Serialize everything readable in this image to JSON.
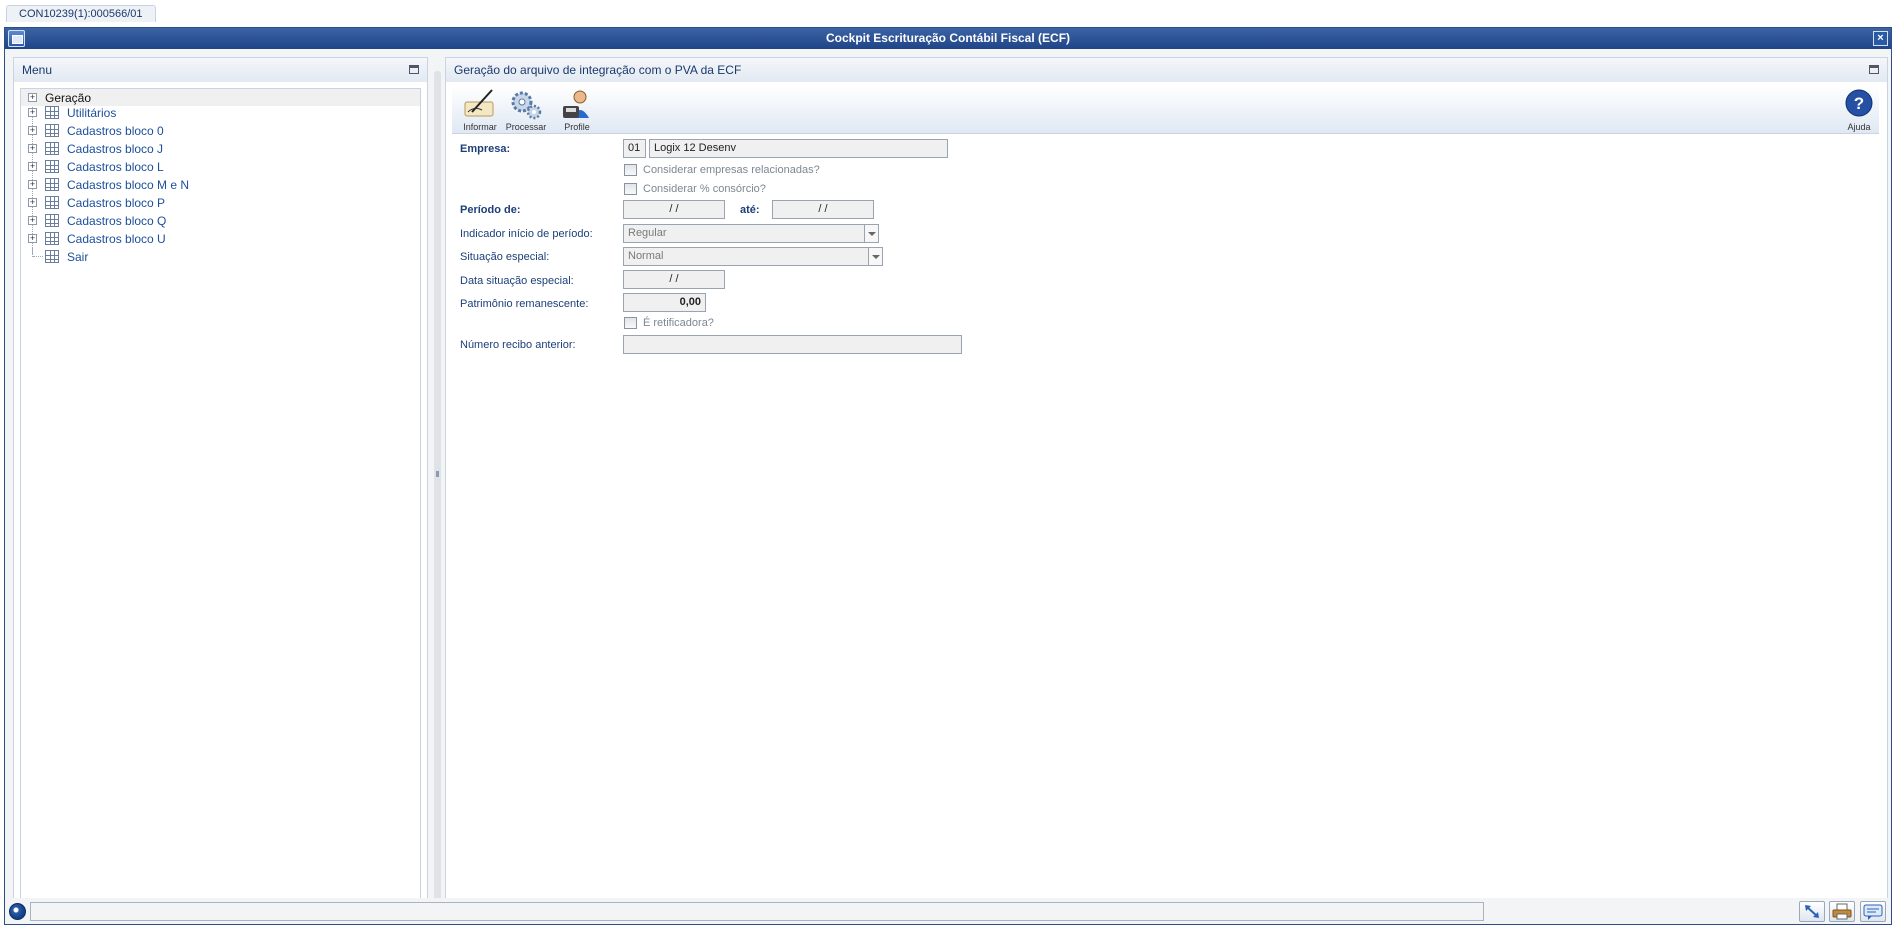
{
  "tab": {
    "label": "CON10239(1):000566/01"
  },
  "window": {
    "title": "Cockpit Escrituração Contábil Fiscal (ECF)",
    "close_label": "×"
  },
  "menu": {
    "title": "Menu",
    "items": [
      {
        "label": "Geração",
        "expandable": true,
        "icon": "none",
        "selected": true
      },
      {
        "label": "Utilitários",
        "expandable": true,
        "icon": "grid-icon"
      },
      {
        "label": "Cadastros bloco 0",
        "expandable": true,
        "icon": "grid-icon"
      },
      {
        "label": "Cadastros bloco J",
        "expandable": true,
        "icon": "grid-icon"
      },
      {
        "label": "Cadastros bloco L",
        "expandable": true,
        "icon": "grid-icon"
      },
      {
        "label": "Cadastros bloco M e N",
        "expandable": true,
        "icon": "grid-icon"
      },
      {
        "label": "Cadastros bloco P",
        "expandable": true,
        "icon": "grid-icon"
      },
      {
        "label": "Cadastros bloco Q",
        "expandable": true,
        "icon": "grid-icon"
      },
      {
        "label": "Cadastros bloco U",
        "expandable": true,
        "icon": "grid-icon"
      },
      {
        "label": "Sair",
        "expandable": false,
        "icon": "grid-icon"
      }
    ],
    "expand_glyph": "+"
  },
  "main": {
    "title": "Geração do arquivo de integração com o PVA da ECF",
    "toolbar": {
      "informar": "Informar",
      "processar": "Processar",
      "profile": "Profile",
      "ajuda": "Ajuda"
    },
    "form": {
      "empresa_label": "Empresa:",
      "empresa_code": "01",
      "empresa_name": "Logix 12 Desenv",
      "considerar_empresas_label": "Considerar empresas relacionadas?",
      "considerar_consorcio_label": "Considerar % consórcio?",
      "periodo_de_label": "Período de:",
      "periodo_de_value": "/ /",
      "ate_label": "até:",
      "ate_value": "/ /",
      "indicador_label": "Indicador início de período:",
      "indicador_value": "Regular",
      "situacao_label": "Situação especial:",
      "situacao_value": "Normal",
      "data_situacao_label": "Data situação especial:",
      "data_situacao_value": "/ /",
      "patrimonio_label": "Patrimônio remanescente:",
      "patrimonio_value": "0,00",
      "retificadora_label": "É retificadora?",
      "recibo_label": "Número recibo anterior:",
      "recibo_value": ""
    }
  },
  "colors": {
    "title_bar": "#1f4588",
    "label": "#1c3f78",
    "link": "#1c4f9c"
  }
}
